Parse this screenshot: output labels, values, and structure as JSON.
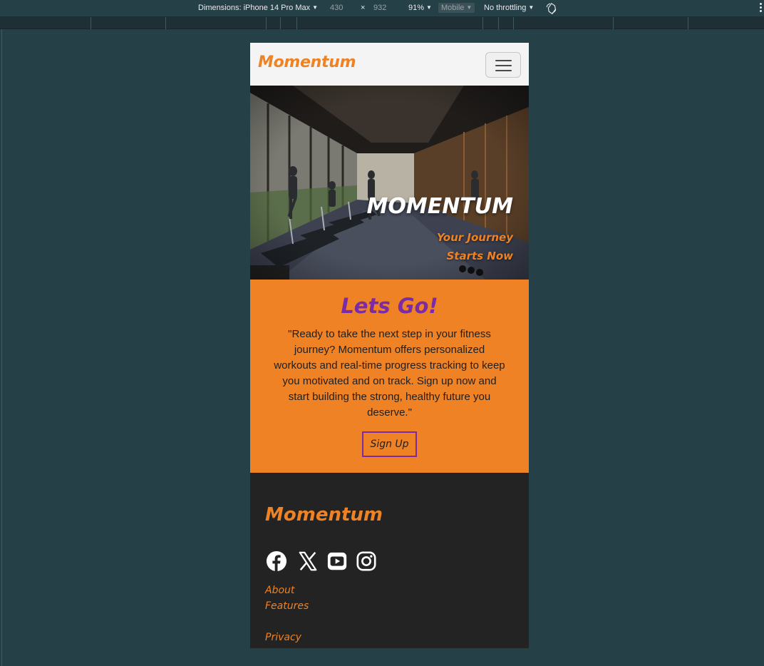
{
  "devtools": {
    "dimensions_label": "Dimensions: iPhone 14 Pro Max",
    "width": "430",
    "times": "×",
    "height": "932",
    "zoom": "91%",
    "mode": "Mobile",
    "throttling": "No throttling"
  },
  "nav": {
    "brand": "Momentum"
  },
  "hero": {
    "title": "MOMENTUM",
    "subtitle": "Your Journey Starts Now"
  },
  "cta": {
    "heading": "Lets Go!",
    "body": "\"Ready to take the next step in your fitness journey? Momentum offers personalized workouts and real-time progress tracking to keep you motivated and on track. Sign up now and start building the strong, healthy future you deserve.\"",
    "button": "Sign Up"
  },
  "footer": {
    "brand": "Momentum",
    "social": [
      "facebook-icon",
      "x-icon",
      "youtube-icon",
      "instagram-icon"
    ],
    "links": [
      "About",
      "Features",
      "Privacy"
    ]
  },
  "colors": {
    "accent": "#ee8224",
    "purple": "#7b2aa8",
    "footer_bg": "#232323",
    "devtools_bg": "#264047"
  }
}
